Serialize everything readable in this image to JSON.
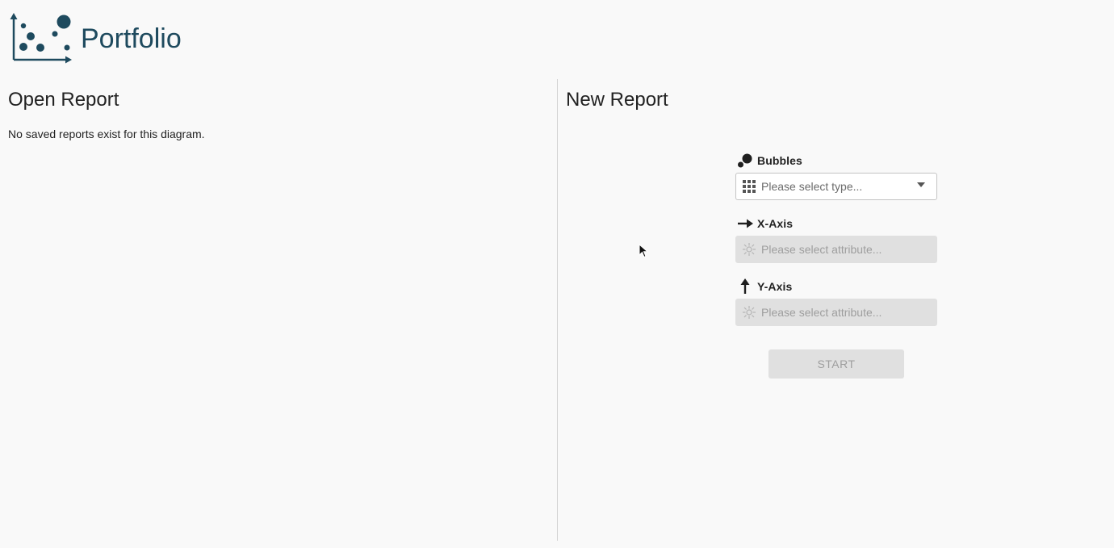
{
  "header": {
    "title": "Portfolio",
    "logo_icon": "bubble-chart-logo-icon",
    "brand_color": "#1e4a5e"
  },
  "open_report": {
    "title": "Open Report",
    "empty_message": "No saved reports exist for this diagram."
  },
  "new_report": {
    "title": "New Report",
    "bubbles": {
      "label": "Bubbles",
      "icon": "bubbles-icon",
      "select_icon": "grid-icon",
      "placeholder": "Please select type...",
      "enabled": true
    },
    "x_axis": {
      "label": "X-Axis",
      "icon": "arrow-right-icon",
      "select_icon": "attribute-icon",
      "placeholder": "Please select attribute...",
      "enabled": false
    },
    "y_axis": {
      "label": "Y-Axis",
      "icon": "arrow-up-icon",
      "select_icon": "attribute-icon",
      "placeholder": "Please select attribute...",
      "enabled": false
    },
    "start_label": "START",
    "start_enabled": false
  }
}
